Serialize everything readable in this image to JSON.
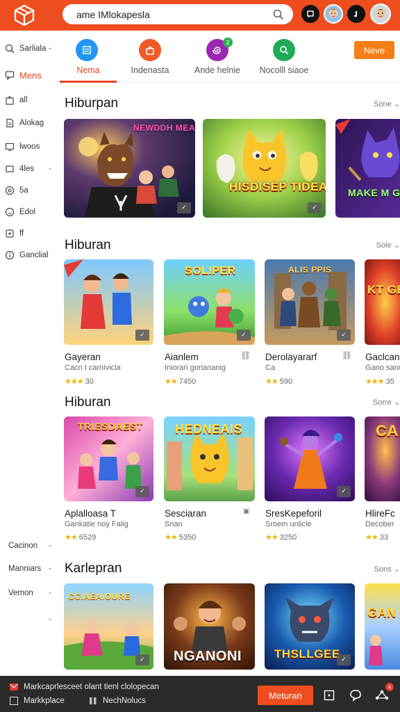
{
  "search": {
    "value": "ame IMlokapesla"
  },
  "sidebar": {
    "items": [
      {
        "label": "Sarliala",
        "icon": "search-icon"
      },
      {
        "label": "Mens",
        "icon": "chat-icon"
      },
      {
        "label": "all",
        "icon": "bag-icon"
      },
      {
        "label": "Alokag",
        "icon": "document-icon"
      },
      {
        "label": "lwoos",
        "icon": "screen-icon"
      },
      {
        "label": "4les",
        "icon": "box-icon"
      },
      {
        "label": "5a",
        "icon": "circle-icon"
      },
      {
        "label": "Edol",
        "icon": "smile-icon"
      },
      {
        "label": "ff",
        "icon": "tag-icon"
      },
      {
        "label": "Ganclial",
        "icon": "info-icon"
      }
    ],
    "lower_items": [
      {
        "label": "Cacinon"
      },
      {
        "label": "Manniars"
      },
      {
        "label": "Vemon"
      }
    ]
  },
  "tabs": [
    {
      "label": "Nema",
      "icon": "list-icon",
      "color": "#2196f3"
    },
    {
      "label": "Indenasta",
      "icon": "bag-icon",
      "color": "#f05a28"
    },
    {
      "label": "Ande helnie",
      "icon": "swirl-icon",
      "color": "#9c27b0",
      "badge": "2"
    },
    {
      "label": "Nocolll siaoe",
      "icon": "magnifier-icon",
      "color": "#1faa59"
    }
  ],
  "new_button": "Neve",
  "sections": [
    {
      "title": "Hiburpan",
      "more": "Sone",
      "cards": [
        {
          "caption": "NEWDDH MEAMRAGS DIDGS",
          "theme": "wolf"
        },
        {
          "caption": "HISDISEP TIDEAAN",
          "theme": "cat"
        },
        {
          "caption": "MAKE M GEAE",
          "theme": "purple"
        }
      ]
    },
    {
      "title": "Hiburan",
      "more": "Soie",
      "games": [
        {
          "title": "Gayeran",
          "sub": "Cacn I carnivicla",
          "rating": "30",
          "stars": "★★★",
          "caption": ""
        },
        {
          "title": "Aianlem",
          "sub": "Iniorari goriananig",
          "rating": "7450",
          "stars": "★★",
          "caption": "SOLIPER"
        },
        {
          "title": "Derolayararf",
          "sub": "Ca",
          "rating": "590",
          "stars": "★★",
          "caption": "ALIS PPIS"
        },
        {
          "title": "Gaclcan",
          "sub": "Gano sanrala",
          "rating": "35",
          "stars": "★★★",
          "caption": "KT GE"
        }
      ]
    },
    {
      "title": "Hiburan",
      "more": "Sorre",
      "games": [
        {
          "title": "Aplalloasa T",
          "sub": "Gankatie noy Falig",
          "rating": "6529",
          "stars": "★★",
          "caption": "TRIESDAEST"
        },
        {
          "title": "Sesciaran",
          "sub": "Snan",
          "rating": "5350",
          "stars": "★★",
          "caption": "HEDNEAIS"
        },
        {
          "title": "SresKepeforil",
          "sub": "Sroem unlicle",
          "rating": "3250",
          "stars": "★★",
          "caption": ""
        },
        {
          "title": "HlireFc",
          "sub": "Decober",
          "rating": "33",
          "stars": "★★",
          "caption": "CA"
        }
      ]
    },
    {
      "title": "Karlepran",
      "more": "Sons",
      "games": [
        {
          "caption": "CCIAEAIOURE"
        },
        {
          "caption": "NGANONI"
        },
        {
          "caption": "THSLLGEE"
        },
        {
          "caption": "GAN"
        }
      ]
    }
  ],
  "bottom": {
    "message": "Markcaprlesceet olant tienl clolopecan",
    "marketplace": "Markkplace",
    "notices": "NechNolucs",
    "return_button": "Meturan",
    "badge": "4"
  },
  "colors": {
    "brand": "#ee4d1f",
    "accent": "#f47f16",
    "star": "#f5b301"
  }
}
